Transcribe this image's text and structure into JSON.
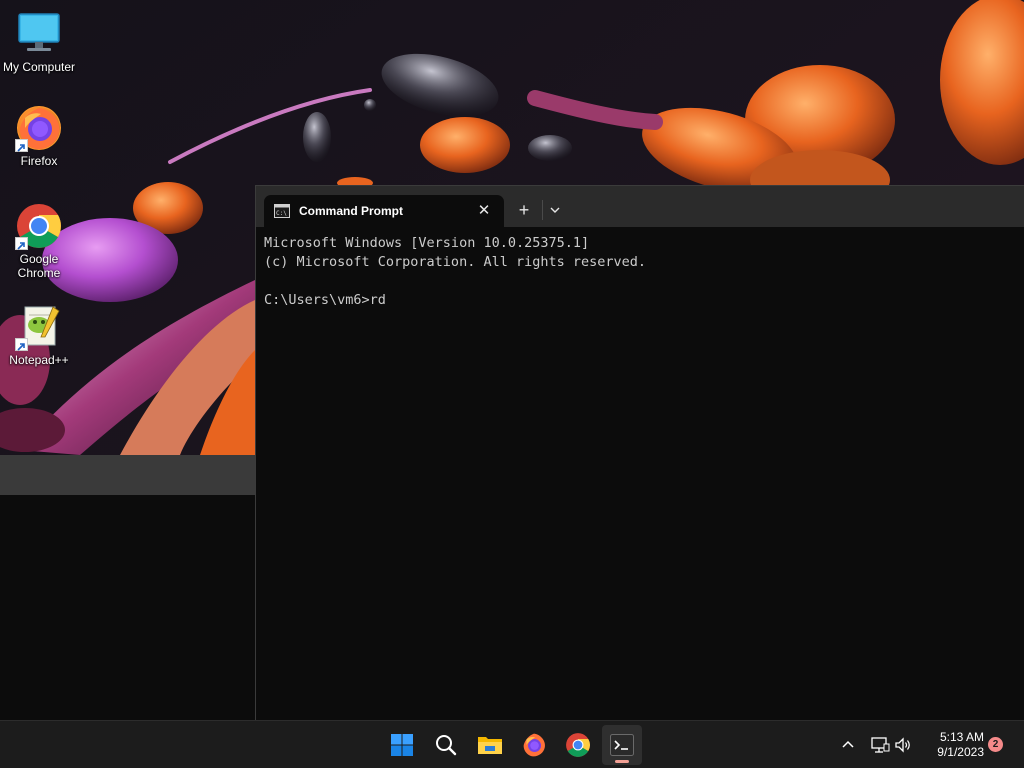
{
  "desktop": {
    "icons": [
      {
        "label": "My Computer"
      },
      {
        "label": "Firefox"
      },
      {
        "label": "Google Chrome"
      },
      {
        "label": "Notepad++"
      }
    ]
  },
  "terminal": {
    "tab_title": "Command Prompt",
    "close_glyph": "✕",
    "new_tab_glyph": "+",
    "lines": [
      "Microsoft Windows [Version 10.0.25375.1]",
      "(c) Microsoft Corporation. All rights reserved.",
      "",
      "C:\\Users\\vm6>rd"
    ]
  },
  "taskbar": {
    "apps": [
      "start-icon",
      "search-icon",
      "file-explorer-icon",
      "firefox-icon",
      "chrome-icon",
      "terminal-icon"
    ],
    "active_app": "terminal-icon",
    "clock_time": "5:13 AM",
    "clock_date": "9/1/2023",
    "notification_count": "2"
  },
  "colors": {
    "terminal_bg": "#0c0c0c",
    "tabbar_bg": "#2b2b2b",
    "taskbar_bg": "#1c1c1c",
    "console_text": "#cccccc",
    "badge": "#f58a8a"
  }
}
